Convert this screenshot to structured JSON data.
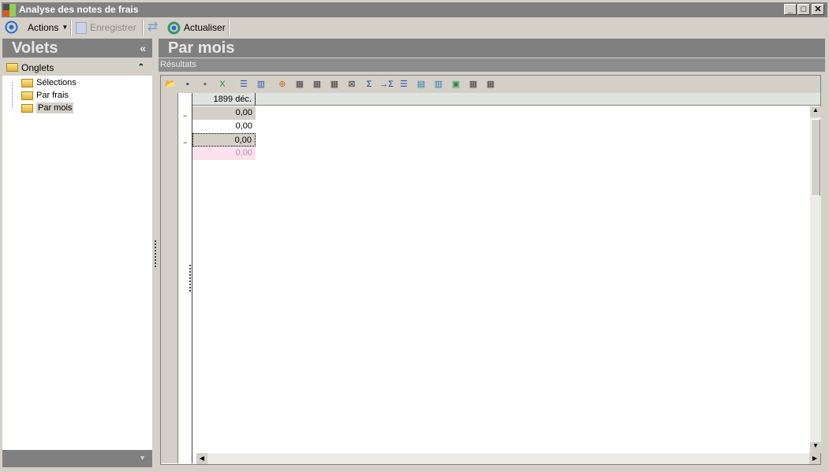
{
  "window": {
    "title": "Analyse des notes de frais",
    "minimize": "_",
    "maximize": "□",
    "close": "✕"
  },
  "toolbar": {
    "actions": "Actions",
    "save": "Enregistrer",
    "refresh": "Actualiser"
  },
  "left_pane": {
    "title": "Volets",
    "collapse": "«",
    "section": "Onglets",
    "section_toggle": "⌃",
    "items": [
      {
        "label": "Sélections"
      },
      {
        "label": "Par frais"
      },
      {
        "label": "Par mois",
        "selected": true
      }
    ]
  },
  "main": {
    "title": "Par mois",
    "subtitle": "Résultats",
    "grid_toolbar_icons": [
      "open-icon",
      "save-icon",
      "print-icon",
      "excel-icon",
      "rows-layout-icon",
      "columns-layout-icon",
      "add-field-icon",
      "grid-icon",
      "grid-lines-icon",
      "grid-dotted-icon",
      "swap-axes-icon",
      "sort-sum-icon",
      "add-total-icon",
      "fit-columns-icon",
      "row-totals-icon",
      "column-totals-icon",
      "grand-totals-icon",
      "add-row-icon",
      "remove-row-icon"
    ],
    "grid": {
      "column_header": "1899 déc.",
      "rows": [
        "0,00",
        "0,00",
        "0,00",
        "0,00"
      ]
    }
  },
  "colors": {
    "header_gray": "#808080",
    "panel": "#d4d0c8",
    "pink_row": "#fbe0ee"
  }
}
